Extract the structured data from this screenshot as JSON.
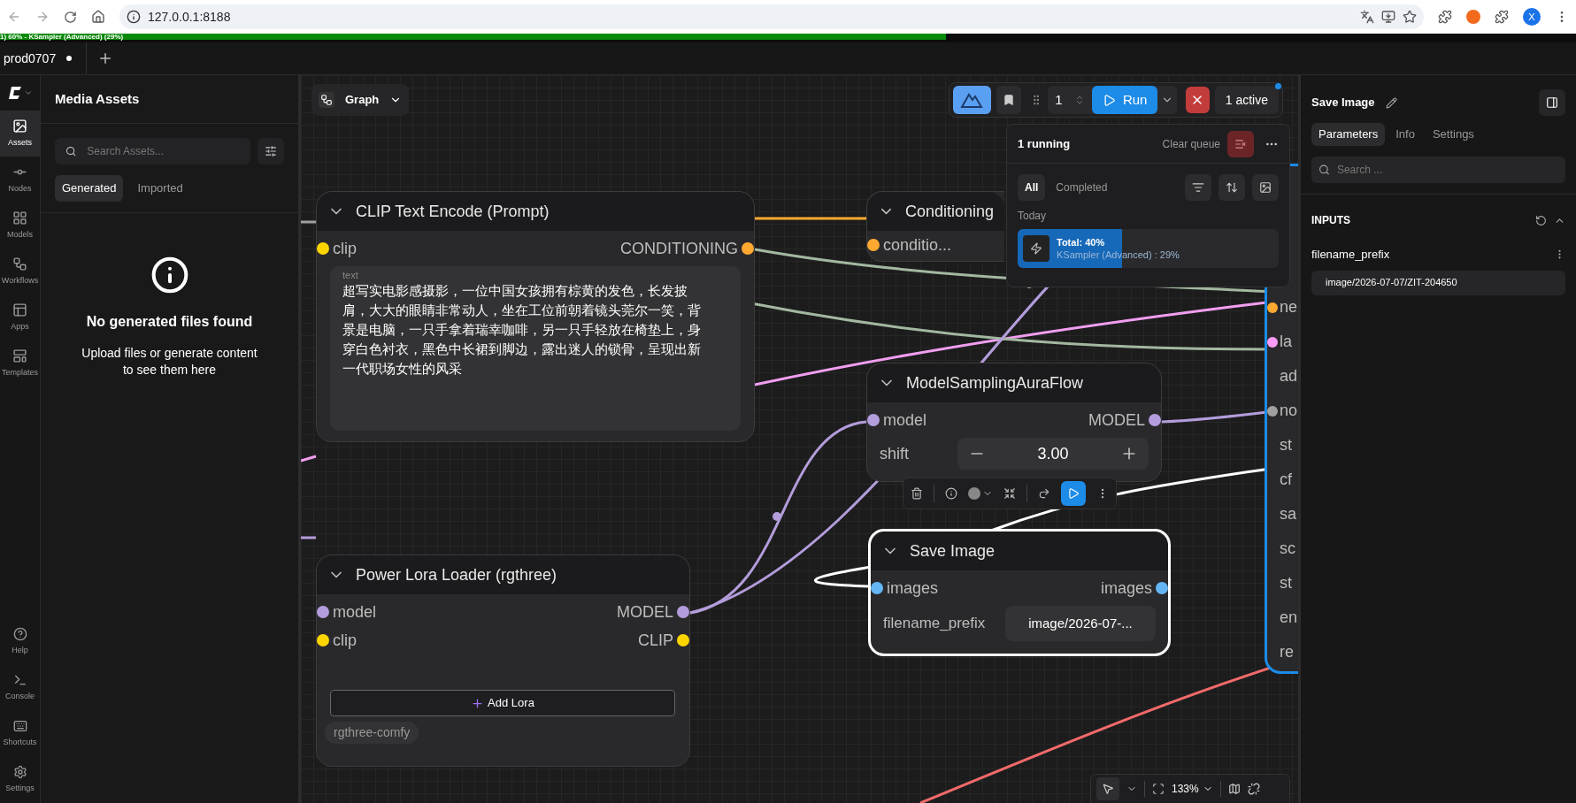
{
  "browser": {
    "url": "127.0.0.1:8188",
    "avatar": "X"
  },
  "progress": {
    "title": "1) 60% - KSampler (Advanced) (29%)",
    "level": 0.6
  },
  "tabs": [
    {
      "title": "prod0707",
      "unsaved": true
    }
  ],
  "rail": {
    "items": [
      {
        "label": "Assets",
        "selected": true
      },
      {
        "label": "Nodes",
        "selected": false
      },
      {
        "label": "Models",
        "selected": false
      },
      {
        "label": "Workflows",
        "selected": false
      },
      {
        "label": "Apps",
        "selected": false
      },
      {
        "label": "Templates",
        "selected": false
      }
    ],
    "bottom": [
      {
        "label": "Help"
      },
      {
        "label": "Console"
      },
      {
        "label": "Shortcuts"
      },
      {
        "label": "Settings"
      }
    ]
  },
  "assets": {
    "title": "Media Assets",
    "search_placeholder": "Search Assets...",
    "tabs": [
      {
        "label": "Generated",
        "selected": true
      },
      {
        "label": "Imported",
        "selected": false
      }
    ],
    "empty_title": "No generated files found",
    "empty_message": "Upload files or generate content to see them here"
  },
  "canvas": {
    "graph_button": "Graph",
    "run_count": "1",
    "run": "Run",
    "active": "1 active",
    "zoom": "133%",
    "queue": {
      "title": "1 running",
      "clear": "Clear queue",
      "filters": [
        {
          "label": "All",
          "selected": true
        },
        {
          "label": "Completed",
          "selected": false
        }
      ],
      "group": "Today",
      "job": {
        "total": "Total: 40%",
        "detail": "KSampler (Advanced) : 29%",
        "level": 0.4
      }
    },
    "clip_node": {
      "title": "CLIP Text Encode (Prompt)",
      "input": {
        "label": "clip",
        "color": "#ffd500"
      },
      "output": {
        "label": "CONDITIONING",
        "color": "#ffa931"
      },
      "text_label": "text",
      "text": "超写实电影感摄影，一位中国女孩拥有棕黄的发色，长发披肩，大大的眼睛非常动人，坐在工位前朝着镜头莞尔一笑，背景是电脑，一只手拿着瑞幸咖啡，另一只手轻放在椅垫上，身穿白色衬衣，黑色中长裙到脚边，露出迷人的锁骨，呈现出新一代职场女性的风采"
    },
    "conditioning_node": {
      "title": "Conditioning",
      "input": {
        "label": "conditio...",
        "color": "#ffa931"
      }
    },
    "aura_node": {
      "title": "ModelSamplingAuraFlow",
      "input": {
        "label": "model",
        "color": "#b39ddb"
      },
      "output": {
        "label": "MODEL",
        "color": "#b39ddb"
      },
      "widget": {
        "label": "shift",
        "value": "3.00"
      }
    },
    "save_node": {
      "title": "Save Image",
      "selected": true,
      "input": {
        "label": "images",
        "color": "#64b5f6"
      },
      "output": {
        "label": "images",
        "color": "#64b5f6"
      },
      "widget": {
        "label": "filename_prefix",
        "value": "image/2026-07-..."
      }
    },
    "lora_node": {
      "title": "Power Lora Loader (rgthree)",
      "slots": [
        {
          "input": {
            "label": "model",
            "color": "#b39ddb"
          },
          "output": {
            "label": "MODEL",
            "color": "#b39ddb"
          }
        },
        {
          "input": {
            "label": "clip",
            "color": "#ffd500"
          },
          "output": {
            "label": "CLIP",
            "color": "#ffd500"
          }
        }
      ],
      "add_button": "Add Lora",
      "tag": "rgthree-comfy"
    },
    "sampler_node": {
      "running": true,
      "labels": [
        {
          "label": "ne",
          "color": "#ffa931"
        },
        {
          "label": "la",
          "color": "#ff9cf9"
        },
        {
          "label": "ad"
        },
        {
          "label": "no",
          "color": "#a0a0a0"
        },
        {
          "label": "st"
        },
        {
          "label": "cf"
        },
        {
          "label": "sa"
        },
        {
          "label": "sc"
        },
        {
          "label": "st"
        },
        {
          "label": "en"
        },
        {
          "label": "re"
        }
      ]
    }
  },
  "right_panel": {
    "title": "Save Image",
    "tabs": [
      {
        "label": "Parameters",
        "selected": true
      },
      {
        "label": "Info",
        "selected": false
      },
      {
        "label": "Settings",
        "selected": false
      }
    ],
    "search_placeholder": "Search ...",
    "section": "INPUTS",
    "field_label": "filename_prefix",
    "field_value": "image/2026-07-07/ZIT-204650"
  }
}
